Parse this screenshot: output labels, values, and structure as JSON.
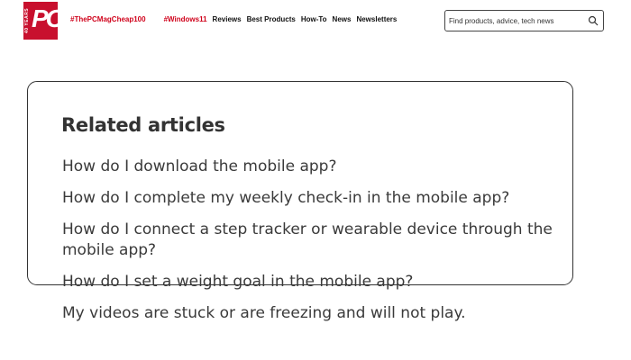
{
  "header": {
    "logo": {
      "text": "PC",
      "years": "40 YEARS"
    },
    "nav": {
      "tag1": "#ThePCMagCheap100",
      "tag2": "#Windows11",
      "items": [
        "Reviews",
        "Best Products",
        "How-To",
        "News",
        "Newsletters"
      ]
    },
    "search": {
      "placeholder": "Find products, advice, tech news"
    }
  },
  "related": {
    "title": "Related articles",
    "articles": [
      "How do I download the mobile app?",
      "How do I complete my weekly check-in in the mobile app?",
      "How do I connect a step tracker or wearable device through the mobile app?",
      "How do I set a weight goal in the mobile app?",
      "My videos are stuck or are freezing and will not play."
    ]
  },
  "colors": {
    "brand": "#c8102e",
    "tag": "#d0021b",
    "text": "#3a3a3a"
  }
}
